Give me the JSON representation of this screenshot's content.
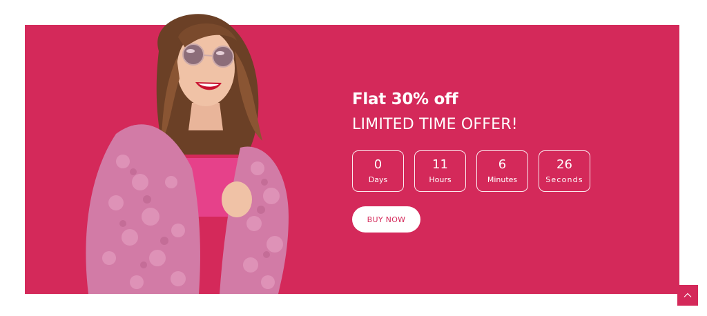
{
  "promo": {
    "headline": "Flat 30% off",
    "subheadline": "LIMITED TIME OFFER!",
    "cta_label": "BUY NOW",
    "accent_color": "#d4295a"
  },
  "countdown": [
    {
      "value": "0",
      "label": "Days"
    },
    {
      "value": "11",
      "label": "Hours"
    },
    {
      "value": "6",
      "label": "Minutes"
    },
    {
      "value": "26",
      "label": "Seconds"
    }
  ],
  "icons": {
    "scroll_top": "chevron-up-icon"
  }
}
